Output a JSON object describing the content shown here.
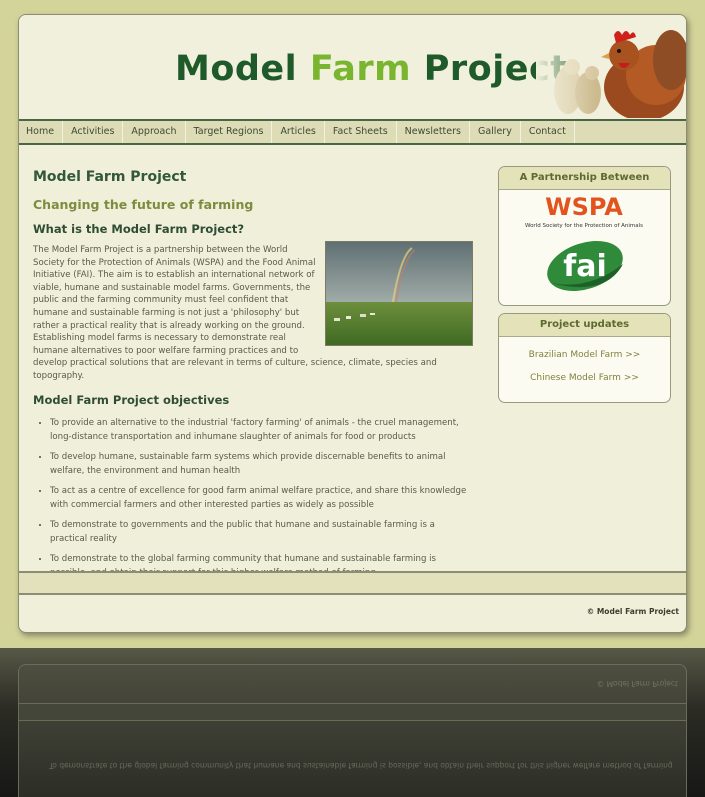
{
  "site": {
    "logo_part1": "Model ",
    "logo_part2": "Farm",
    "logo_part3": " Project"
  },
  "nav": [
    "Home",
    "Activities",
    "Approach",
    "Target Regions",
    "Articles",
    "Fact Sheets",
    "Newsletters",
    "Gallery",
    "Contact"
  ],
  "main": {
    "title": "Model Farm Project",
    "subtitle": "Changing the future of farming",
    "what_heading": "What is the Model Farm Project?",
    "intro": "The Model Farm Project is a partnership between the World Society for the Protection of Animals (WSPA) and the Food Animal Initiative (FAI). The aim is to establish an international network of viable, humane and sustainable model farms. Governments, the public and the farming community must feel confident that humane and sustainable farming is not just a 'philosophy' but rather a practical reality that is already working on the ground. Establishing model farms is necessary to demonstrate real humane alternatives to poor welfare farming practices and to develop practical solutions that are relevant in terms of culture, science, climate, species and topography.",
    "objectives_heading": "Model Farm Project objectives",
    "objectives": [
      "To provide an alternative to the industrial 'factory farming' of animals - the cruel management, long-distance transportation and inhumane slaughter of animals for food or products",
      "To develop humane, sustainable farm systems which provide discernable benefits to animal welfare, the environment and human health",
      "To act as a centre of excellence for good farm animal welfare practice, and share this knowledge with commercial farmers and other interested parties as widely as possible",
      "To demonstrate to governments and the public that humane and sustainable farming is a practical reality",
      "To demonstrate to the global farming community that humane and sustainable farming is possible, and obtain their support for this higher welfare method of farming"
    ]
  },
  "sidebar": {
    "partnership_title": "A Partnership Between",
    "wspa_logo_text": "WSPA",
    "wspa_tagline": "World Society for the Protection of Animals",
    "fai_logo_text": "fai",
    "updates_title": "Project updates",
    "links": [
      "Brazilian Model Farm >>",
      "Chinese Model Farm >>"
    ]
  },
  "footer": {
    "copyright": "© Model Farm Project"
  },
  "colors": {
    "background": "#d3d49a",
    "page": "#f0efd9",
    "nav": "#dedcb6",
    "logo_dark_green": "#1e5a2a",
    "logo_light_green": "#7ab52f",
    "wspa_orange": "#e2531e",
    "fai_green": "#2f8a3a"
  }
}
